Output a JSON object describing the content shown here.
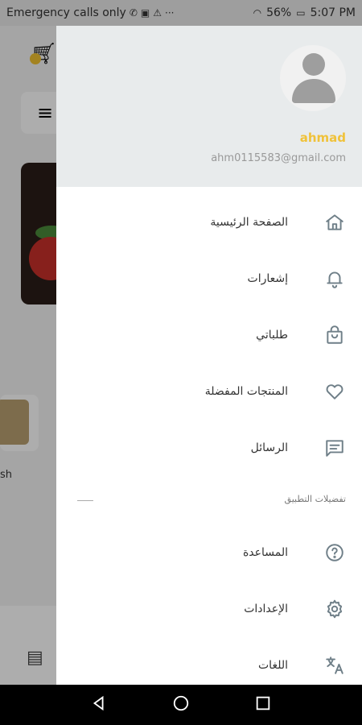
{
  "status_bar": {
    "carrier_text": "Emergency calls only",
    "battery": "56%",
    "time": "5:07 PM"
  },
  "background": {
    "visible_text": "sh"
  },
  "drawer": {
    "user": {
      "name": "ahmad",
      "email": "ahm0115583@gmail.com"
    },
    "items": [
      {
        "label": "الصفحة الرئيسية",
        "icon": "home-icon"
      },
      {
        "label": "إشعارات",
        "icon": "bell-icon"
      },
      {
        "label": "طلباتي",
        "icon": "shopping-bag-icon"
      },
      {
        "label": "المنتجات المفضلة",
        "icon": "heart-icon"
      },
      {
        "label": "الرسائل",
        "icon": "message-icon"
      }
    ],
    "section_title": "تفضيلات التطبيق",
    "pref_items": [
      {
        "label": "المساعدة",
        "icon": "help-icon"
      },
      {
        "label": "الإعدادات",
        "icon": "gear-icon"
      },
      {
        "label": "اللغات",
        "icon": "translate-icon"
      }
    ]
  },
  "colors": {
    "accent": "#f0c23a",
    "header_bg": "#e8ebec",
    "icon": "#6f7f88"
  }
}
